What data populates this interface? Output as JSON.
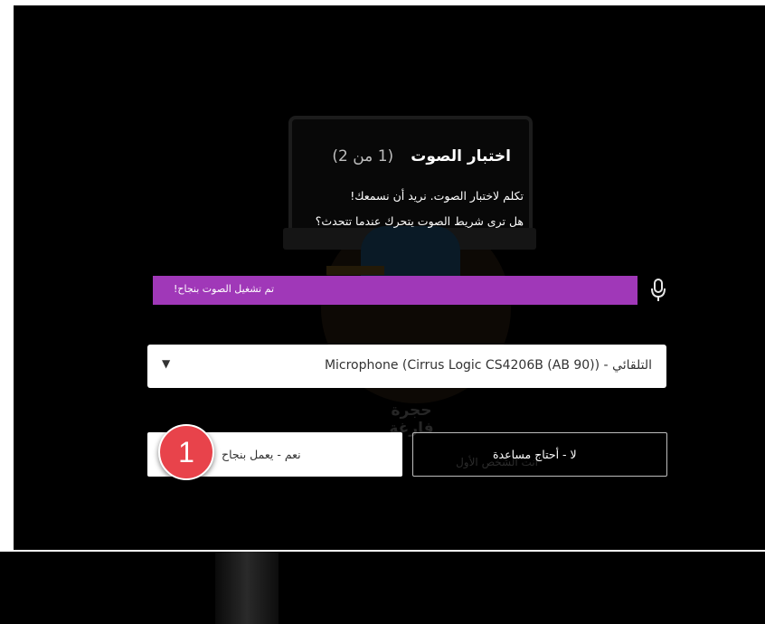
{
  "dialog": {
    "title": "اختبار الصوت",
    "step": "(1 من 2)",
    "instruction_line1": "تكلم لاختبار الصوت. نريد أن نسمعك!",
    "instruction_line2": "هل ترى شريط الصوت يتحرك عندما تتحدث؟"
  },
  "audio_meter": {
    "status_text": "تم تشغيل الصوت بنجاح!",
    "level_fraction": 1.0,
    "color": "#a038b8"
  },
  "microphone_select": {
    "selected_value": "التلقائي - Microphone (Cirrus Logic CS4206B (AB 90))"
  },
  "buttons": {
    "yes_label": "نعم - يعمل بنجاح",
    "no_label": "لا - أحتاج مساعدة"
  },
  "background": {
    "room_label": "حجرة فارغة",
    "room_subtext": "أنت الشخص الأول"
  },
  "annotation": {
    "step_number": "1",
    "badge_color": "#e8434b"
  },
  "icons": {
    "microphone": "microphone-icon",
    "dropdown": "triangle-down-icon"
  }
}
